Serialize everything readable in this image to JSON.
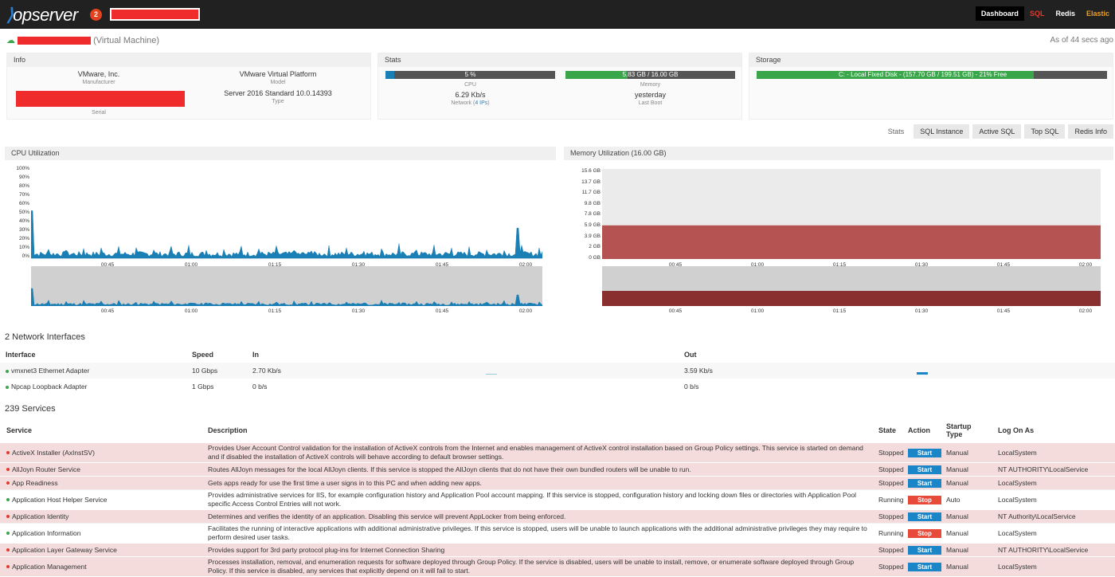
{
  "topbar": {
    "logo_mark": "",
    "logo_text": "opserver",
    "badge": "2",
    "nav": [
      "Dashboard",
      "SQL",
      "Redis",
      "Elastic"
    ]
  },
  "server": {
    "type": "(Virtual Machine)",
    "as_of": "As of 44 secs ago"
  },
  "info": {
    "header": "Info",
    "manufacturer": "VMware, Inc.",
    "manufacturer_label": "Manufacturer",
    "model": "VMware Virtual Platform",
    "model_label": "Model",
    "serial_label": "Serial",
    "type": "Server 2016 Standard 10.0.14393",
    "type_label": "Type"
  },
  "stats": {
    "header": "Stats",
    "cpu": "5 %",
    "cpu_pct": 5,
    "cpu_label": "CPU",
    "memory": "5.83 GB / 16.00 GB",
    "memory_pct": 36.4,
    "memory_label": "Memory",
    "network": "6.29 Kb/s",
    "network_label": "Network (",
    "network_ips": "4 IPs",
    "network_label_end": ")",
    "last_boot": "yesterday",
    "last_boot_label": "Last Boot"
  },
  "storage": {
    "header": "Storage",
    "disk": "C: - Local Fixed Disk - (157.70 GB / 199.51 GB) - 21% Free",
    "used_pct": 79
  },
  "tabs": [
    "Stats",
    "SQL Instance",
    "Active SQL",
    "Top SQL",
    "Redis Info"
  ],
  "cpu_chart": {
    "title": "CPU Utilization",
    "yticks": [
      "100%",
      "90%",
      "80%",
      "70%",
      "60%",
      "50%",
      "40%",
      "30%",
      "20%",
      "10%",
      "0%"
    ],
    "xticks": [
      "00:45",
      "01:00",
      "01:15",
      "01:30",
      "01:45",
      "02:00"
    ],
    "color": "#1a7fb5"
  },
  "mem_chart": {
    "title": "Memory Utilization (16.00 GB)",
    "yticks": [
      "15.6 GB",
      "13.7 GB",
      "11.7 GB",
      "9.8 GB",
      "7.8 GB",
      "5.9 GB",
      "3.9 GB",
      "2 GB",
      "0 GB"
    ],
    "xticks": [
      "00:45",
      "01:00",
      "01:15",
      "01:30",
      "01:45",
      "02:00"
    ],
    "color": "#b55252"
  },
  "network": {
    "title": "2 Network Interfaces",
    "headers": [
      "Interface",
      "Speed",
      "In",
      "Out"
    ],
    "rows": [
      {
        "name": "vmxnet3 Ethernet Adapter",
        "speed": "10 Gbps",
        "in": "2.70 Kb/s",
        "out": "3.59 Kb/s"
      },
      {
        "name": "Npcap Loopback Adapter",
        "speed": "1 Gbps",
        "in": "0 b/s",
        "out": "0 b/s"
      }
    ]
  },
  "services": {
    "title": "239 Services",
    "headers": [
      "Service",
      "Description",
      "State",
      "Action",
      "Startup Type",
      "Log On As"
    ],
    "rows": [
      {
        "name": "ActiveX Installer (AxInstSV)",
        "desc": "Provides User Account Control validation for the installation of ActiveX controls from the Internet and enables management of ActiveX control installation based on Group Policy settings. This service is started on demand and if disabled the installation of ActiveX controls will behave according to default browser settings.",
        "state": "Stopped",
        "action": "Start",
        "startup": "Manual",
        "logon": "LocalSystem"
      },
      {
        "name": "AllJoyn Router Service",
        "desc": "Routes AllJoyn messages for the local AllJoyn clients. If this service is stopped the AllJoyn clients that do not have their own bundled routers will be unable to run.",
        "state": "Stopped",
        "action": "Start",
        "startup": "Manual",
        "logon": "NT AUTHORITY\\LocalService"
      },
      {
        "name": "App Readiness",
        "desc": "Gets apps ready for use the first time a user signs in to this PC and when adding new apps.",
        "state": "Stopped",
        "action": "Start",
        "startup": "Manual",
        "logon": "LocalSystem"
      },
      {
        "name": "Application Host Helper Service",
        "desc": "Provides administrative services for IIS, for example configuration history and Application Pool account mapping. If this service is stopped, configuration history and locking down files or directories with Application Pool specific Access Control Entries will not work.",
        "state": "Running",
        "action": "Stop",
        "startup": "Auto",
        "logon": "LocalSystem"
      },
      {
        "name": "Application Identity",
        "desc": "Determines and verifies the identity of an application. Disabling this service will prevent AppLocker from being enforced.",
        "state": "Stopped",
        "action": "Start",
        "startup": "Manual",
        "logon": "NT Authority\\LocalService"
      },
      {
        "name": "Application Information",
        "desc": "Facilitates the running of interactive applications with additional administrative privileges. If this service is stopped, users will be unable to launch applications with the additional administrative privileges they may require to perform desired user tasks.",
        "state": "Running",
        "action": "Stop",
        "startup": "Manual",
        "logon": "LocalSystem"
      },
      {
        "name": "Application Layer Gateway Service",
        "desc": "Provides support for 3rd party protocol plug-ins for Internet Connection Sharing",
        "state": "Stopped",
        "action": "Start",
        "startup": "Manual",
        "logon": "NT AUTHORITY\\LocalService"
      },
      {
        "name": "Application Management",
        "desc": "Processes installation, removal, and enumeration requests for software deployed through Group Policy. If the service is disabled, users will be unable to install, remove, or enumerate software deployed through Group Policy. If this service is disabled, any services that explicitly depend on it will fail to start.",
        "state": "Stopped",
        "action": "Start",
        "startup": "Manual",
        "logon": "LocalSystem"
      }
    ]
  }
}
